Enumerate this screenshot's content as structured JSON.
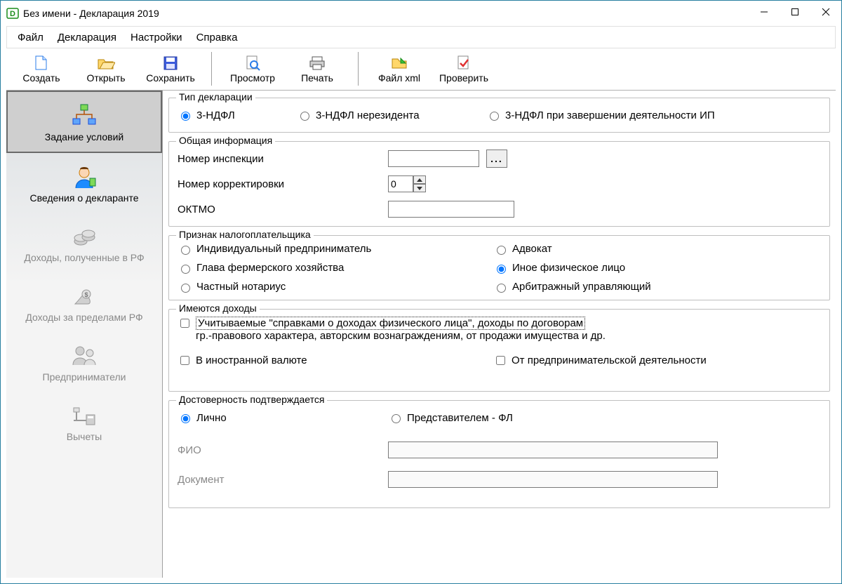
{
  "window": {
    "title": "Без имени - Декларация 2019"
  },
  "menu": {
    "file": "Файл",
    "decl": "Декларация",
    "settings": "Настройки",
    "help": "Справка"
  },
  "toolbar": {
    "create": "Создать",
    "open": "Открыть",
    "save": "Сохранить",
    "preview": "Просмотр",
    "print": "Печать",
    "xml": "Файл xml",
    "check": "Проверить"
  },
  "sidebar": {
    "conditions": "Задание условий",
    "declarant": "Сведения о декларанте",
    "income_rf": "Доходы, полученные в РФ",
    "income_foreign": "Доходы за пределами РФ",
    "entrepreneurs": "Предприниматели",
    "deductions": "Вычеты"
  },
  "decl_type": {
    "legend": "Тип декларации",
    "opt1": "3-НДФЛ",
    "opt2": "3-НДФЛ нерезидента",
    "opt3": "3-НДФЛ при завершении деятельности ИП"
  },
  "general": {
    "legend": "Общая информация",
    "inspection": "Номер инспекции",
    "inspection_value": "",
    "ellipsis": "...",
    "correction": "Номер корректировки",
    "correction_value": "0",
    "oktmo": "ОКТМО",
    "oktmo_value": ""
  },
  "taxpayer": {
    "legend": "Признак налогоплательщика",
    "ip": "Индивидуальный предприниматель",
    "advokat": "Адвокат",
    "farmer": "Глава фермерского хозяйства",
    "other": "Иное физическое лицо",
    "notary": "Частный нотариус",
    "arbitr": "Арбитражный управляющий"
  },
  "income": {
    "legend": "Имеются доходы",
    "spravki_1": "Учитываемые \"справками о доходах физического лица\", доходы по договорам",
    "spravki_2": "гр.-правового характера, авторским вознаграждениям, от продажи имущества и др.",
    "foreign": "В иностранной валюте",
    "business": "От предпринимательской деятельности"
  },
  "trust": {
    "legend": "Достоверность подтверждается",
    "self": "Лично",
    "rep": "Представителем - ФЛ",
    "fio": "ФИО",
    "fio_value": "",
    "doc": "Документ",
    "doc_value": ""
  }
}
